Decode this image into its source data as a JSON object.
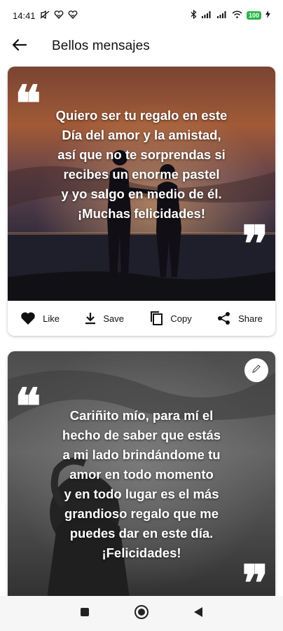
{
  "status_bar": {
    "time": "14:41",
    "left_icons": [
      "silent-icon",
      "heart-shield-icon",
      "heart-shield-icon"
    ],
    "right_icons": [
      "bluetooth-icon",
      "signal-icon",
      "signal-icon",
      "wifi-icon",
      "battery-icon"
    ],
    "battery_text": "100"
  },
  "app_bar": {
    "title": "Bellos mensajes",
    "back_icon": "arrow-left-icon"
  },
  "cards": [
    {
      "text": "Quiero ser tu regalo en este\nDía del amor y la amistad,\nasí que no te sorprendas si\nrecibes un enorme pastel\ny yo salgo en medio de él.\n¡Muchas felicidades!",
      "open_quote": "❝",
      "close_quote": "❞"
    },
    {
      "text": "Cariñito mío, para mí el\nhecho de saber que estás\na mi lado brindándome tu\namor en todo momento\ny en todo lugar es el más\ngrandioso regalo que me\npuedes dar en este día.\n¡Felicidades!",
      "open_quote": "❝",
      "close_quote": "❞"
    }
  ],
  "actions": {
    "like": "Like",
    "save": "Save",
    "copy": "Copy",
    "share": "Share"
  },
  "colors": {
    "battery": "#2db34a",
    "card_bg": "#ffffff",
    "nav_bg": "#f6f6f6"
  },
  "nav_bar": [
    "recents-square-icon",
    "home-circle-icon",
    "back-triangle-icon"
  ]
}
